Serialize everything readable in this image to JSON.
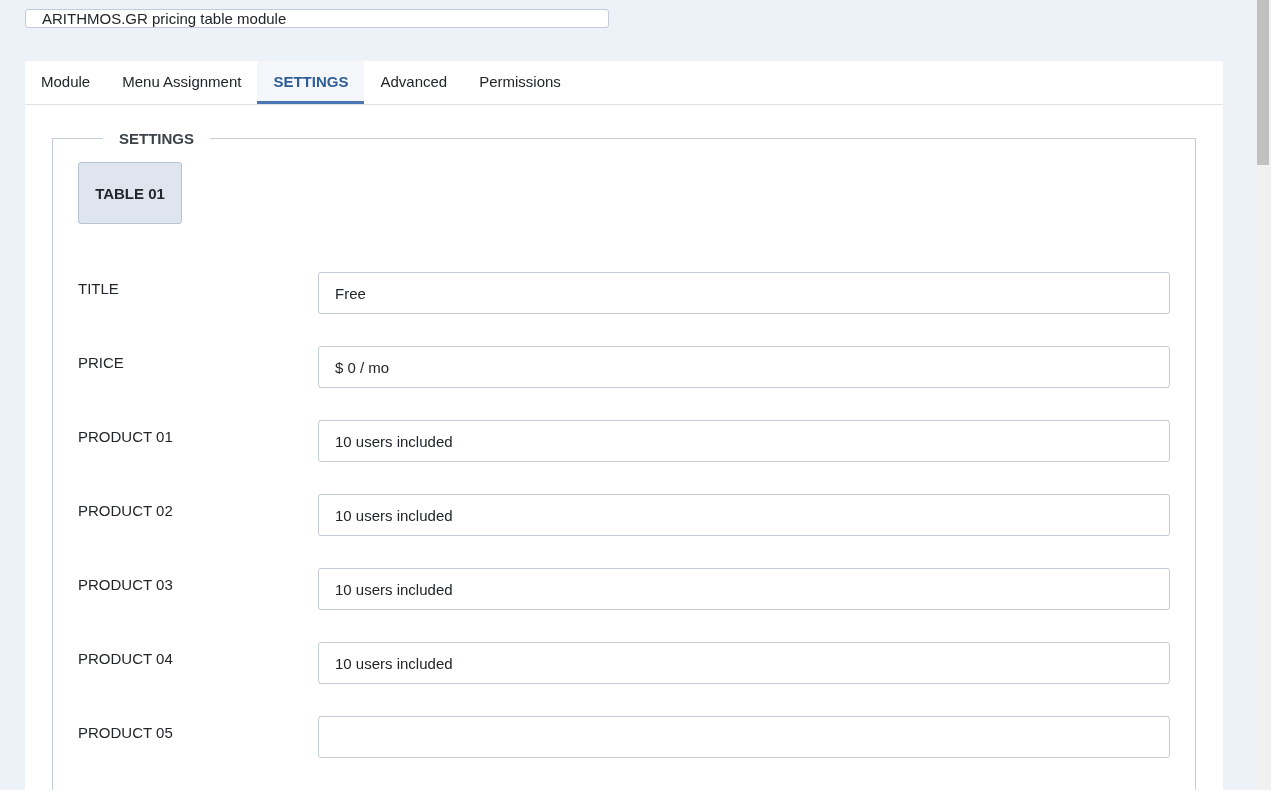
{
  "title_field": {
    "value": "ARITHMOS.GR pricing table module"
  },
  "tabs": [
    {
      "label": "Module",
      "selected": false
    },
    {
      "label": "Menu Assignment",
      "selected": false
    },
    {
      "label": "SETTINGS",
      "selected": true
    },
    {
      "label": "Advanced",
      "selected": false
    },
    {
      "label": "Permissions",
      "selected": false
    }
  ],
  "fieldset": {
    "legend": "SETTINGS",
    "table_button": "TABLE 01",
    "fields": [
      {
        "label": "TITLE",
        "value": "Free"
      },
      {
        "label": "PRICE",
        "value": "$ 0 / mo"
      },
      {
        "label": "PRODUCT 01",
        "value": "10 users included"
      },
      {
        "label": "PRODUCT 02",
        "value": "10 users included"
      },
      {
        "label": "PRODUCT 03",
        "value": "10 users included"
      },
      {
        "label": "PRODUCT 04",
        "value": "10 users included"
      },
      {
        "label": "PRODUCT 05"
      }
    ]
  }
}
